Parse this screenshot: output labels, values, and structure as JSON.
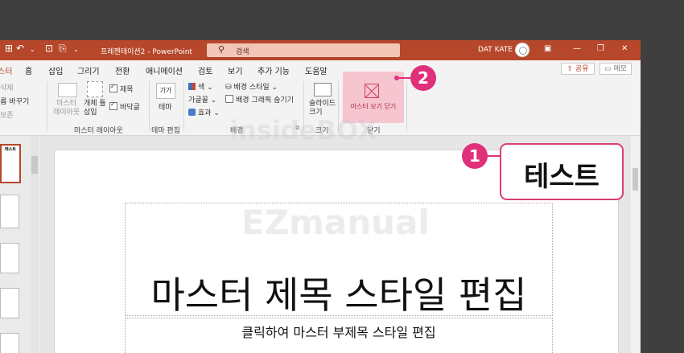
{
  "titlebar": {
    "doc_title": "프레젠테이션2 - PowerPoint",
    "search_placeholder": "검색",
    "user_name": "DAT KATE",
    "qat_icons": [
      "undo-icon",
      "redo-icon",
      "custom-icon",
      "save-icon"
    ]
  },
  "tabs": [
    "스터",
    "홈",
    "삽입",
    "그리기",
    "전환",
    "애니메이션",
    "검토",
    "보기",
    "추가 기능",
    "도움말"
  ],
  "active_tab": "스터",
  "share": "공유",
  "memo": "메모",
  "ribbon": {
    "edit_master": {
      "items": [
        "삭제",
        "이름 바꾸기",
        "보존"
      ]
    },
    "master_layout": {
      "label": "마스터 레이아웃",
      "master_layout_btn": "마스터\n레이아웃",
      "insert_placeholder": "개체 틀\n삽입",
      "title_cb": "제목",
      "footer_cb": "바닥글"
    },
    "edit_theme": {
      "label": "테마 편집",
      "theme_btn": "테마",
      "theme_sample": "가가"
    },
    "background": {
      "label": "배경",
      "colors": "색",
      "fonts": "글꼴",
      "effects": "효과",
      "bg_styles": "배경 스타일",
      "hide_bg": "배경 그래픽 숨기기"
    },
    "size": {
      "label": "크기",
      "slide_size": "슬라이드\n크기"
    },
    "close": {
      "label": "닫기",
      "close_btn": "마스터 보기 닫기"
    }
  },
  "slide": {
    "title": "마스터 제목 스타일 편집",
    "subtitle": "클릭하여 마스터 부제목 스타일 편집"
  },
  "thumb_label": "테스트",
  "callout": {
    "number": "1",
    "text": "테스트"
  },
  "badge2": "2",
  "watermark": [
    "insideBOX",
    "EZmanual"
  ],
  "colors": {
    "accent": "#b7472a",
    "highlight": "#e0307a",
    "close_bg": "#f5c5d0"
  }
}
